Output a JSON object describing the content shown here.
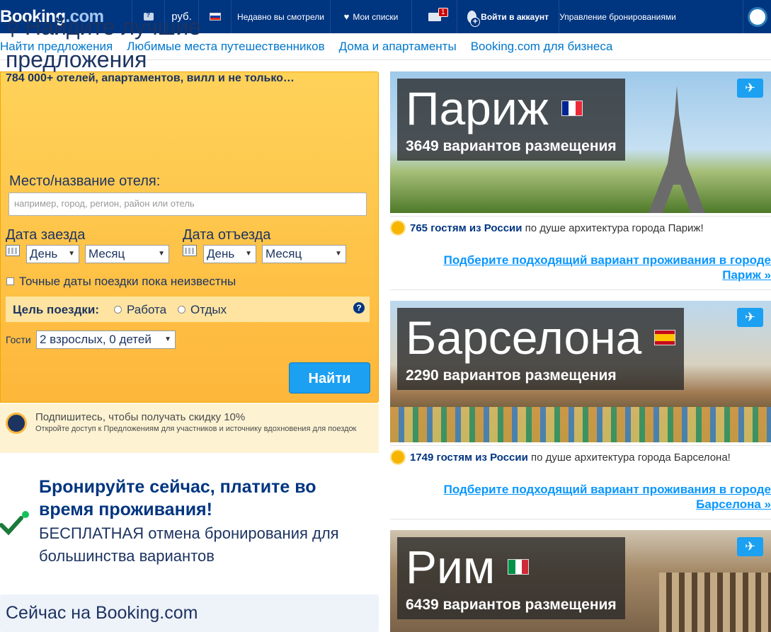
{
  "header": {
    "logo_main": "Booking",
    "logo_suffix": ".com",
    "currency": "руб.",
    "recent": "Недавно вы смотрели",
    "lists": "Мои списки",
    "messages_badge": "1",
    "login": "Войти в аккаунт",
    "manage": "Управление бронированиями"
  },
  "nav": {
    "tabs": [
      "Найти предложения",
      "Любимые места путешественников",
      "Дома и апартаменты",
      "Booking.com для бизнеса"
    ]
  },
  "search": {
    "title": "Найдите лучшие предложения",
    "subtitle": "784 000+ отелей, апартаментов, вилл и не только…",
    "place_label": "Место/название отеля:",
    "place_placeholder": "например, город, регион, район или отель",
    "checkin_label": "Дата заезда",
    "checkout_label": "Дата отъезда",
    "day": "День",
    "month": "Месяц",
    "flexible_dates": "Точные даты поездки пока неизвестны",
    "purpose_label": "Цель поездки:",
    "purpose_work": "Работа",
    "purpose_leisure": "Отдых",
    "help": "?",
    "guests_label": "Гости",
    "guests_value": "2 взрослых, 0 детей",
    "button": "Найти"
  },
  "subscribe": {
    "title": "Подпишитесь, чтобы получать скидку 10%",
    "desc": "Откройте доступ к Предложениям для участников и источнику вдохновения для поездок"
  },
  "promo": {
    "title": "Бронируйте сейчас, платите во время проживания!",
    "desc": "БЕСПЛАТНАЯ отмена бронирования для большинства вариантов"
  },
  "now": {
    "title": "Сейчас на Booking.com"
  },
  "destinations": [
    {
      "city": "Париж",
      "count": "3649 вариантов размещения",
      "guests": "765 гостям из России",
      "liked": "по душе архитектура города Париж!",
      "link_line1": "Подберите подходящий вариант проживания в городе",
      "link_line2": "Париж »",
      "flag_colors": [
        "#002395",
        "#ffffff",
        "#ed2939"
      ]
    },
    {
      "city": "Барселона",
      "count": "2290 вариантов размещения",
      "guests": "1749 гостям из России",
      "liked": "по душе архитектура города Барселона!",
      "link_line1": "Подберите подходящий вариант проживания в городе",
      "link_line2": "Барселона »",
      "flag_colors": [
        "#c60b1e",
        "#ffc400",
        "#c60b1e"
      ]
    },
    {
      "city": "Рим",
      "count": "6439 вариантов размещения",
      "flag_colors": [
        "#009246",
        "#ffffff",
        "#ce2b37"
      ]
    }
  ],
  "colors": {
    "brand_dark": "#003580",
    "brand_link": "#0077cc",
    "search_yellow": "#febb02",
    "button_blue": "#1ba0f2"
  }
}
